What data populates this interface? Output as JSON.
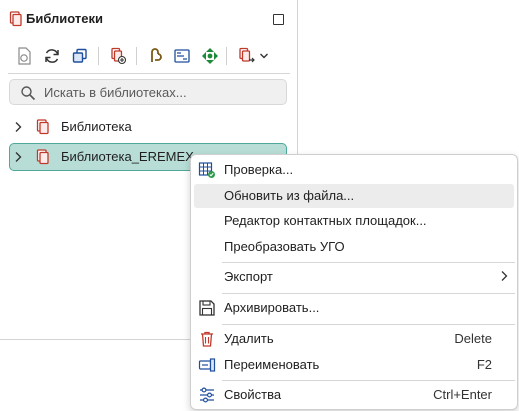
{
  "panel": {
    "title": "Библиотеки",
    "header_icon": "library-book-icon",
    "toolbar": [
      {
        "name": "open-library-icon"
      },
      {
        "name": "refresh-icon"
      },
      {
        "name": "copy-icon"
      },
      {
        "name": "add-library-icon"
      },
      {
        "name": "edit-component-icon"
      },
      {
        "name": "image-icon"
      },
      {
        "name": "move-icon"
      },
      {
        "name": "import-library-icon"
      },
      {
        "name": "chevron-down-icon"
      }
    ],
    "search": {
      "placeholder": "Искать в библиотеках..."
    },
    "tree": [
      {
        "label": "Библиотека",
        "selected": false
      },
      {
        "label": "Библиотека_EREMEX",
        "selected": true
      }
    ]
  },
  "context_menu": {
    "items": [
      {
        "label": "Проверка...",
        "icon": "table-check-icon"
      },
      {
        "label": "Обновить из файла...",
        "hover": true
      },
      {
        "label": "Редактор контактных площадок..."
      },
      {
        "label": "Преобразовать УГО"
      },
      {
        "label": "Экспорт",
        "submenu": true
      },
      {
        "label": "Архивировать...",
        "icon": "save-icon"
      },
      {
        "label": "Удалить",
        "icon": "trash-icon",
        "shortcut": "Delete"
      },
      {
        "label": "Переименовать",
        "icon": "rename-icon",
        "shortcut": "F2"
      },
      {
        "label": "Свойства",
        "icon": "properties-icon",
        "shortcut": "Ctrl+Enter"
      }
    ]
  },
  "colors": {
    "selection_bg": "#b8ddd7",
    "selection_border": "#4fa89a",
    "hover_bg": "#ececec",
    "book_red": "#c0392b"
  }
}
